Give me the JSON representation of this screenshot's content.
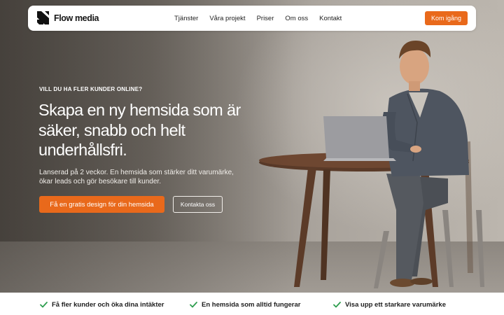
{
  "brand": {
    "name": "Flow media",
    "logo_icon": "flowmedia-logo-icon"
  },
  "nav": {
    "links": [
      "Tjänster",
      "Våra projekt",
      "Priser",
      "Om oss",
      "Kontakt"
    ],
    "cta_label": "Kom igång"
  },
  "hero": {
    "eyebrow": "VILL DU HA FLER KUNDER ONLINE?",
    "headline": "Skapa en ny hemsida som är säker, snabb och helt underhållsfri.",
    "subtext": "Lanserad på 2 veckor. En hemsida som stärker ditt varumärke, ökar leads och gör besökare till kunder.",
    "primary_cta": "Få en gratis design för din hemsida",
    "secondary_cta": "Kontakta oss"
  },
  "features": [
    {
      "icon": "check-icon",
      "title": "Få fler kunder och öka dina intäkter"
    },
    {
      "icon": "check-icon",
      "title": "En hemsida som alltid fungerar"
    },
    {
      "icon": "check-icon",
      "title": "Visa upp ett starkare varumärke"
    }
  ],
  "colors": {
    "accent": "#e9691b",
    "check": "#2e9e4f",
    "nav_bg": "#ffffff"
  }
}
